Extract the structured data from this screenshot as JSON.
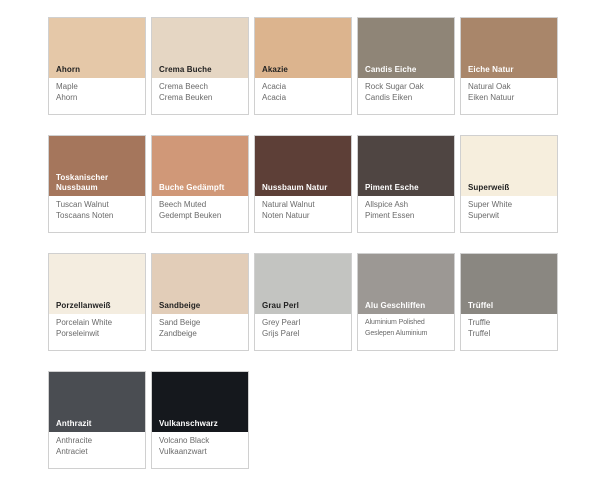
{
  "swatches": [
    {
      "title": "Ahorn",
      "en": "Maple",
      "nl": "Ahorn",
      "color": "#e5c8a8",
      "label": "dark"
    },
    {
      "title": "Crema Buche",
      "en": "Crema Beech",
      "nl": "Crema Beuken",
      "color": "#e5d6c3",
      "label": "dark"
    },
    {
      "title": "Akazie",
      "en": "Acacia",
      "nl": "Acacia",
      "color": "#dcb48e",
      "label": "dark"
    },
    {
      "title": "Candis Eiche",
      "en": "Rock Sugar Oak",
      "nl": "Candis Eiken",
      "color": "#8f8577",
      "label": "light"
    },
    {
      "title": "Eiche Natur",
      "en": "Natural Oak",
      "nl": "Eiken Natuur",
      "color": "#a9866a",
      "label": "light"
    },
    {
      "title": "Toskanischer Nussbaum",
      "en": "Tuscan Walnut",
      "nl": "Toscaans Noten",
      "color": "#a5765c",
      "label": "light"
    },
    {
      "title": "Buche Gedämpft",
      "en": "Beech Muted",
      "nl": "Gedempt Beuken",
      "color": "#d09878",
      "label": "light"
    },
    {
      "title": "Nussbaum Natur",
      "en": "Natural Walnut",
      "nl": "Noten Natuur",
      "color": "#5d3f37",
      "label": "light"
    },
    {
      "title": "Piment Esche",
      "en": "Allspice Ash",
      "nl": "Piment Essen",
      "color": "#4f4542",
      "label": "light"
    },
    {
      "title": "Superweiß",
      "en": "Super White",
      "nl": "Superwit",
      "color": "#f6eedd",
      "label": "dark"
    },
    {
      "title": "Porzellanweiß",
      "en": "Porcelain White",
      "nl": "Porseleinwit",
      "color": "#f4ede0",
      "label": "dark"
    },
    {
      "title": "Sandbeige",
      "en": "Sand Beige",
      "nl": "Zandbeige",
      "color": "#e2cdb8",
      "label": "dark"
    },
    {
      "title": "Grau Perl",
      "en": "Grey Pearl",
      "nl": "Grijs Parel",
      "color": "#c3c4c1",
      "label": "dark"
    },
    {
      "title": "Alu Geschliffen",
      "en": "Aluminium Polished",
      "nl": "Geslepen Aluminium",
      "color": "#9c9894",
      "label": "light"
    },
    {
      "title": "Trüffel",
      "en": "Truffle",
      "nl": "Truffel",
      "color": "#8a8781",
      "label": "light"
    },
    {
      "title": "Anthrazit",
      "en": "Anthracite",
      "nl": "Antraciet",
      "color": "#4a4d52",
      "label": "light"
    },
    {
      "title": "Vulkanschwarz",
      "en": "Volcano Black",
      "nl": "Vulkaanzwart",
      "color": "#15181d",
      "label": "light"
    }
  ]
}
